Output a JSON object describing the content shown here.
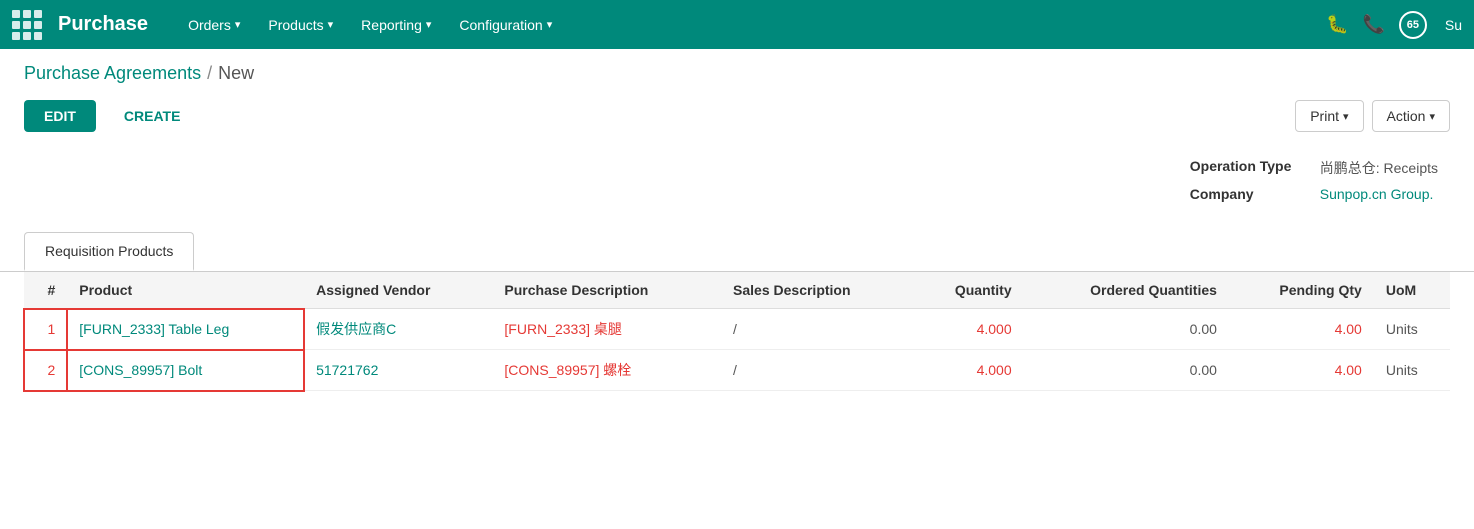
{
  "topnav": {
    "brand": "Purchase",
    "menu": [
      {
        "label": "Orders",
        "id": "orders"
      },
      {
        "label": "Products",
        "id": "products"
      },
      {
        "label": "Reporting",
        "id": "reporting"
      },
      {
        "label": "Configuration",
        "id": "configuration"
      }
    ],
    "badge_count": "65",
    "user_initial": "Su"
  },
  "breadcrumb": {
    "parent_label": "Purchase Agreements",
    "separator": "/",
    "current": "New"
  },
  "toolbar": {
    "edit_label": "EDIT",
    "create_label": "CREATE",
    "print_label": "Print",
    "action_label": "Action"
  },
  "info": {
    "operation_type_label": "Operation Type",
    "operation_type_value": "尚鹏总仓: Receipts",
    "company_label": "Company",
    "company_value": "Sunpop.cn Group."
  },
  "tabs": [
    {
      "label": "Requisition Products",
      "active": true
    }
  ],
  "table": {
    "columns": [
      {
        "key": "num",
        "label": "#",
        "align": "right"
      },
      {
        "key": "product",
        "label": "Product",
        "align": "left"
      },
      {
        "key": "vendor",
        "label": "Assigned Vendor",
        "align": "left"
      },
      {
        "key": "purchase_desc",
        "label": "Purchase Description",
        "align": "left"
      },
      {
        "key": "sales_desc",
        "label": "Sales Description",
        "align": "left"
      },
      {
        "key": "qty",
        "label": "Quantity",
        "align": "right"
      },
      {
        "key": "ordered_qty",
        "label": "Ordered Quantities",
        "align": "right"
      },
      {
        "key": "pending_qty",
        "label": "Pending Qty",
        "align": "right"
      },
      {
        "key": "uom",
        "label": "UoM",
        "align": "left"
      }
    ],
    "rows": [
      {
        "num": "1",
        "product": "[FURN_2333] Table Leg",
        "vendor": "假发供应商C",
        "purchase_desc": "[FURN_2333] 桌腿",
        "sales_desc": "/",
        "qty": "4.000",
        "ordered_qty": "0.00",
        "pending_qty": "4.00",
        "uom": "Units"
      },
      {
        "num": "2",
        "product": "[CONS_89957] Bolt",
        "vendor": "51721762",
        "purchase_desc": "[CONS_89957] 螺栓",
        "sales_desc": "/",
        "qty": "4.000",
        "ordered_qty": "0.00",
        "pending_qty": "4.00",
        "uom": "Units"
      }
    ]
  }
}
